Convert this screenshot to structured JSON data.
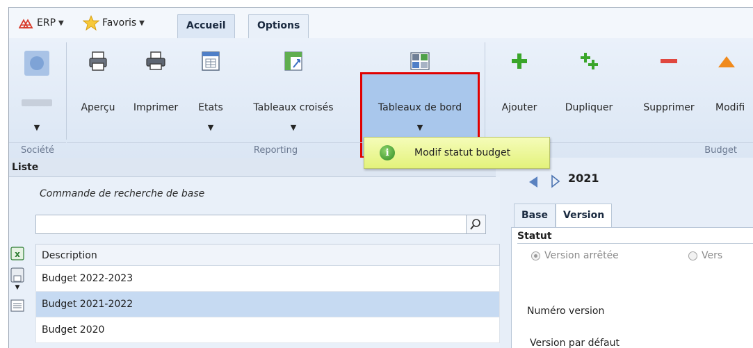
{
  "topbar": {
    "erp_label": "ERP",
    "favoris_label": "Favoris",
    "tabs": [
      {
        "label": "Accueil",
        "active": true
      },
      {
        "label": "Options",
        "active": false
      }
    ]
  },
  "ribbon": {
    "reporting": {
      "apercu": "Aperçu",
      "imprimer": "Imprimer",
      "etats": "Etats",
      "tableaux_croises": "Tableaux croisés",
      "tableaux_de_bord": "Tableaux de bord"
    },
    "budget": {
      "ajouter": "Ajouter",
      "dupliquer": "Dupliquer",
      "supprimer": "Supprimer",
      "modifier": "Modifi"
    },
    "groups": {
      "societe": "Société",
      "reporting": "Reporting",
      "budget": "Budget"
    }
  },
  "tooltip": {
    "icon": "info-icon",
    "text": "Modif statut budget"
  },
  "liste": {
    "title": "Liste",
    "search_caption": "Commande de recherche de base",
    "search_value": "",
    "grid_header": "Description",
    "rows": [
      {
        "description": "Budget 2022-2023",
        "selected": false
      },
      {
        "description": "Budget 2021-2022",
        "selected": true
      },
      {
        "description": "Budget 2020",
        "selected": false
      }
    ]
  },
  "detail": {
    "year": "2021",
    "tabs": [
      {
        "label": "Base",
        "active": false
      },
      {
        "label": "Version",
        "active": true
      }
    ],
    "statut_title": "Statut",
    "radio_arretee": "Version arrêtée",
    "radio_other": "Vers",
    "numero_version_label": "Numéro version",
    "version_defaut_label": "Version par défaut"
  },
  "colors": {
    "highlight_border": "#e00000",
    "tooltip_bg": "#e9f48a",
    "selected_row": "#c6daf2",
    "add_green": "#3aa62a",
    "remove_red": "#e0473f"
  }
}
